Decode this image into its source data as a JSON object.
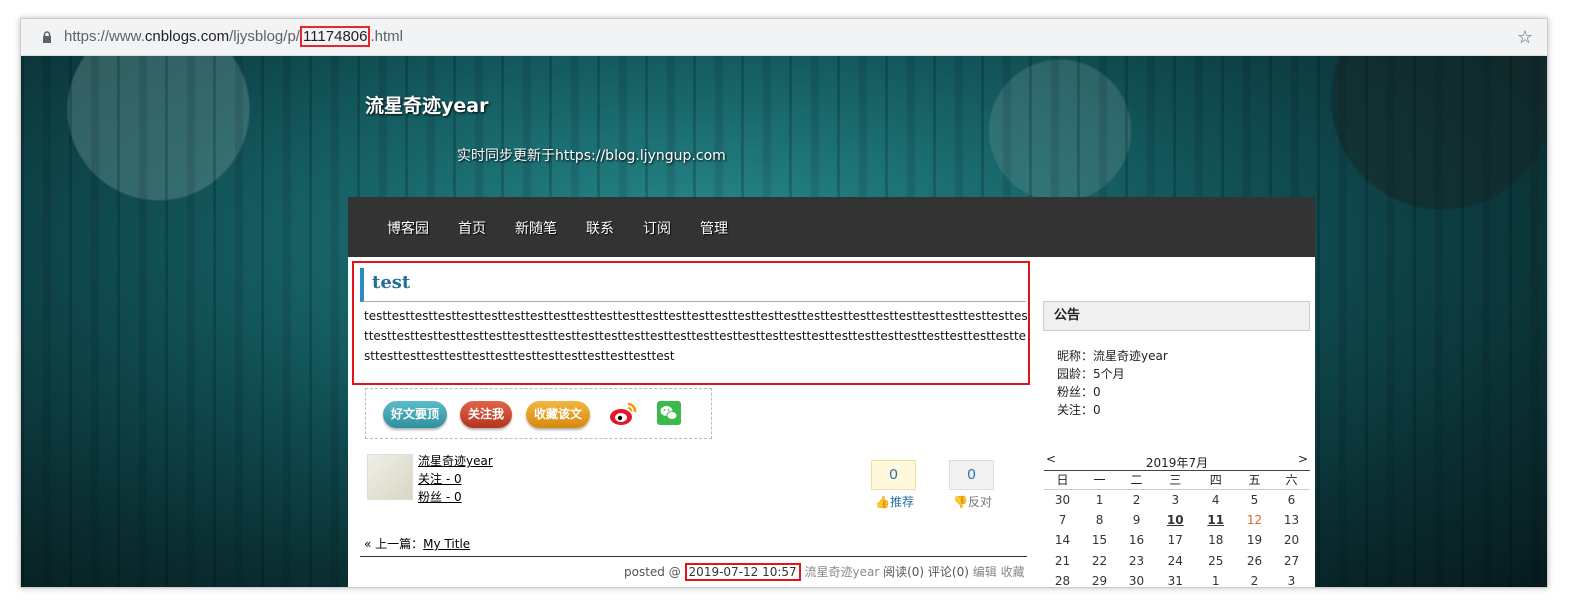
{
  "browser": {
    "url_prefix": "https://www.",
    "url_domain": "cnblogs.com",
    "url_path": "/ljysblog/p/",
    "url_highlight": "11174806",
    "url_suffix": ".html"
  },
  "header": {
    "blog_title": "流星奇迹year",
    "subtitle": "实时同步更新于https://blog.ljyngup.com"
  },
  "nav": [
    "博客园",
    "首页",
    "新随笔",
    "联系",
    "订阅",
    "管理"
  ],
  "post": {
    "title": "test",
    "body": "testtesttesttesttesttesttesttesttesttesttesttesttesttesttesttesttesttesttesttesttesttesttesttesttesttesttesttesttesttesttesttesttesttesttesttesttesttesttesttesttesttesttesttesttesttesttesttesttesttesttesttesttesttesttesttesttesttesttesttesttesttesttesttesttesttesttesttesttesttesttest"
  },
  "share": {
    "good_post": "好文要顶",
    "follow": "关注我",
    "favorite": "收藏该文"
  },
  "author": {
    "name": "流星奇迹year",
    "follow": "关注 - 0",
    "fans": "粉丝 - 0"
  },
  "votes": {
    "digg_count": "0",
    "digg_label": "推荐",
    "bury_count": "0",
    "bury_label": "反对"
  },
  "prev_post": {
    "prefix": "« 上一篇：",
    "title": "My Title"
  },
  "footer": {
    "posted": "posted @ ",
    "datetime": "2019-07-12 10:57",
    "author": " 流星奇迹year ",
    "reads": "阅读(0)",
    "comments": " 评论(0) ",
    "edit": "编辑",
    "fav": " 收藏"
  },
  "sidebar": {
    "notice_title": "公告",
    "nickname": "昵称：流星奇迹year",
    "age": "园龄：5个月",
    "fans": "粉丝：0",
    "follow": "关注：0"
  },
  "calendar": {
    "title": "2019年7月",
    "prev": "<",
    "next": ">",
    "weekdays": [
      "日",
      "一",
      "二",
      "三",
      "四",
      "五",
      "六"
    ],
    "weeks": [
      [
        "30",
        "1",
        "2",
        "3",
        "4",
        "5",
        "6"
      ],
      [
        "7",
        "8",
        "9",
        "10",
        "11",
        "12",
        "13"
      ],
      [
        "14",
        "15",
        "16",
        "17",
        "18",
        "19",
        "20"
      ],
      [
        "21",
        "22",
        "23",
        "24",
        "25",
        "26",
        "27"
      ],
      [
        "28",
        "29",
        "30",
        "31",
        "1",
        "2",
        "3"
      ]
    ]
  }
}
